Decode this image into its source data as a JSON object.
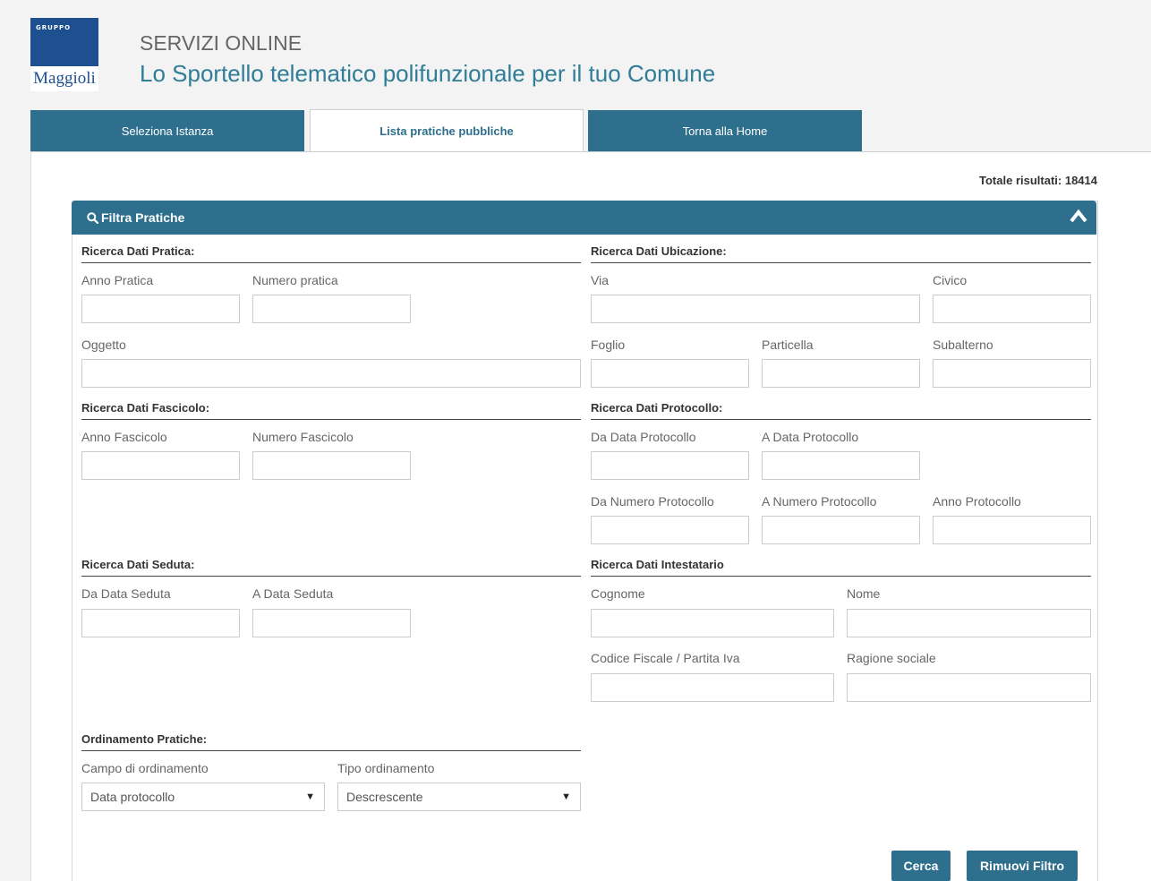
{
  "header": {
    "logo_group": "GRUPPO",
    "logo_brand": "Maggioli",
    "title": "SERVIZI ONLINE",
    "subtitle": "Lo Sportello telematico polifunzionale per il tuo Comune"
  },
  "tabs": [
    {
      "label": "Seleziona Istanza",
      "active": false
    },
    {
      "label": "Lista pratiche pubbliche",
      "active": true
    },
    {
      "label": "Torna alla Home",
      "active": false
    }
  ],
  "totale": "Totale risultati: 18414",
  "panel": {
    "title": "Filtra Pratiche",
    "title_icon": "search-icon",
    "collapse_icon": "chevron-up-icon"
  },
  "sections": {
    "pratica": "Ricerca Dati Pratica:",
    "ubicazione": "Ricerca Dati Ubicazione:",
    "fascicolo": "Ricerca Dati Fascicolo:",
    "protocollo": "Ricerca Dati Protocollo:",
    "seduta": "Ricerca Dati Seduta:",
    "intestatario": "Ricerca Dati Intestatario",
    "ordinamento": "Ordinamento Pratiche:"
  },
  "labels": {
    "anno_pratica": "Anno Pratica",
    "numero_pratica": "Numero pratica",
    "oggetto": "Oggetto",
    "via": "Via",
    "civico": "Civico",
    "foglio": "Foglio",
    "particella": "Particella",
    "subalterno": "Subalterno",
    "anno_fascicolo": "Anno Fascicolo",
    "numero_fascicolo": "Numero Fascicolo",
    "da_data_protocollo": "Da Data Protocollo",
    "a_data_protocollo": "A Data Protocollo",
    "da_numero_protocollo": "Da Numero Protocollo",
    "a_numero_protocollo": "A Numero Protocollo",
    "anno_protocollo": "Anno Protocollo",
    "da_data_seduta": "Da Data Seduta",
    "a_data_seduta": "A Data Seduta",
    "cognome": "Cognome",
    "nome": "Nome",
    "codice_fiscale": "Codice Fiscale / Partita Iva",
    "ragione_sociale": "Ragione sociale",
    "campo_ordinamento": "Campo di ordinamento",
    "tipo_ordinamento": "Tipo ordinamento"
  },
  "selects": {
    "campo_ordinamento": "Data protocollo",
    "tipo_ordinamento": "Descrescente"
  },
  "buttons": {
    "cerca": "Cerca",
    "rimuovi": "Rimuovi Filtro"
  }
}
